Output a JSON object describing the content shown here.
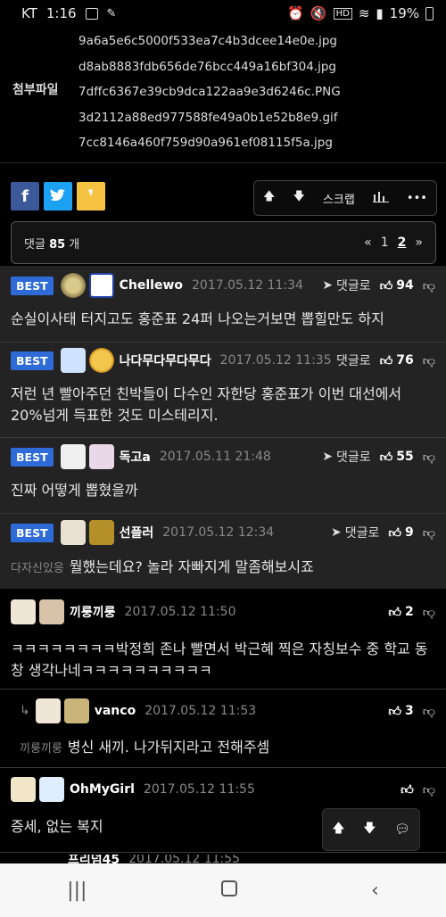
{
  "status": {
    "carrier": "KT",
    "time": "1:16",
    "battery": "19%"
  },
  "attach": {
    "label": "첨부파일",
    "files": [
      "9a6a5e6c5000f533ea7c4b3dcee14e0e.jpg",
      "d8ab8883fdb656de76bcc449a16bf304.jpg",
      "7dffc6367e39cb9dca122aa9e3d6246c.PNG",
      "3d2112a88ed977588fe49a0b1e52b8e9.gif",
      "7cc8146a460f759d90a961ef08115f5a.jpg"
    ]
  },
  "toolbar": {
    "scrap": "스크랩"
  },
  "comments_bar": {
    "prefix": "댓글",
    "count": "85",
    "suffix": "개",
    "pages": [
      "1",
      "2"
    ]
  },
  "reply_label": "댓글로",
  "best_label": "BEST",
  "comments": [
    {
      "nick": "Chellewo",
      "date": "2017.05.12 11:34",
      "likes": "94",
      "text": "순실이사태 터지고도 홍준표 24퍼 나오는거보면 뽑힐만도 하지"
    },
    {
      "nick": "나다무다무다무다",
      "date": "2017.05.12 11:35",
      "likes": "76",
      "text": "저런 년 빨아주던 친박들이 다수인 자한당 홍준표가 이번 대선에서 20%넘게 득표한 것도 미스테리지."
    },
    {
      "nick": "독고a",
      "date": "2017.05.11 21:48",
      "likes": "55",
      "text": "진짜 어떻게 뽑혔을까"
    },
    {
      "nick": "선플러",
      "date": "2017.05.12 12:34",
      "likes": "9",
      "target": "다자신있응",
      "text": "뭘했는데요? 놀라 자빠지게 말좀해보시죠"
    },
    {
      "nick": "끼룽끼룽",
      "date": "2017.05.12 11:50",
      "likes": "2",
      "text": "ㅋㅋㅋㅋㅋㅋㅋㅋ박정희 존나 빨면서 박근혜 찍은 자칭보수 중 학교 동창 생각나네ㅋㅋㅋㅋㅋㅋㅋㅋㅋㅋ"
    },
    {
      "nick": "vanco",
      "date": "2017.05.12 11:53",
      "likes": "3",
      "target": "끼룽끼룽",
      "text": "병신 새끼. 나가뒤지라고 전해주셈"
    },
    {
      "nick": "OhMyGirl",
      "date": "2017.05.12 11:55",
      "likes": "",
      "text": "증세, 없는 복지"
    },
    {
      "nick": "프리덤45",
      "date": "2017.05.12 11:55",
      "likes": "",
      "text": ""
    }
  ],
  "colors": {
    "best": "#2e6bd6",
    "facebook": "#3b5998",
    "twitter": "#1da1f2",
    "share_yellow": "#f5c242"
  },
  "icons": {
    "facebook": "facebook-icon",
    "twitter": "twitter-icon",
    "up": "arrow-up-icon",
    "down": "arrow-down-icon",
    "chart": "chart-icon",
    "more": "more-icon"
  }
}
